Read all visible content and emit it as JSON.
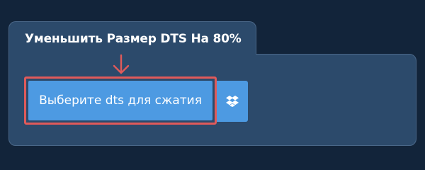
{
  "widget": {
    "title": "Уменьшить Размер DTS На 80%",
    "select_button_label": "Выберите dts для сжатия",
    "dropbox_icon": "dropbox-icon",
    "arrow_icon": "arrow-down-icon",
    "highlight_color": "#e05a5a",
    "button_color": "#4d9ae2",
    "panel_color": "#2c4a6b",
    "background_color": "#12243a"
  }
}
